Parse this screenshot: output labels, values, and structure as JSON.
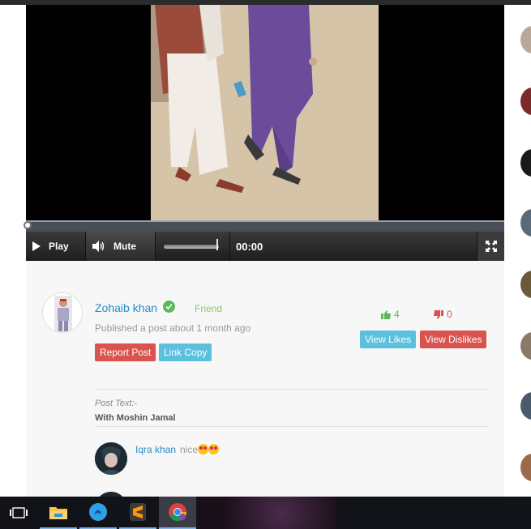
{
  "video": {
    "play_label": "Play",
    "mute_label": "Mute",
    "time": "00:00",
    "progress": 0.0,
    "volume": 1.0
  },
  "post": {
    "author": "Zohaib khan",
    "relation": "Friend",
    "published": "Published a post about 1 month ago",
    "report_label": "Report Post",
    "link_copy_label": "Link Copy",
    "likes": "4",
    "dislikes": "0",
    "view_likes_label": "View Likes",
    "view_dislikes_label": "View Dislikes",
    "text_label": "Post Text:-",
    "text": "With Moshin Jamal"
  },
  "comments": [
    {
      "author": "Iqra khan",
      "text": "nice"
    }
  ],
  "taskbar": {
    "apps": [
      "task-view-icon",
      "file-explorer-icon",
      "app-blue-icon",
      "sublime-text-icon",
      "chrome-icon"
    ]
  },
  "colors": {
    "accent_blue": "#2a8bc8",
    "like_green": "#5cb85c",
    "dislike_red": "#d9534f",
    "info_blue": "#5bc0de"
  }
}
